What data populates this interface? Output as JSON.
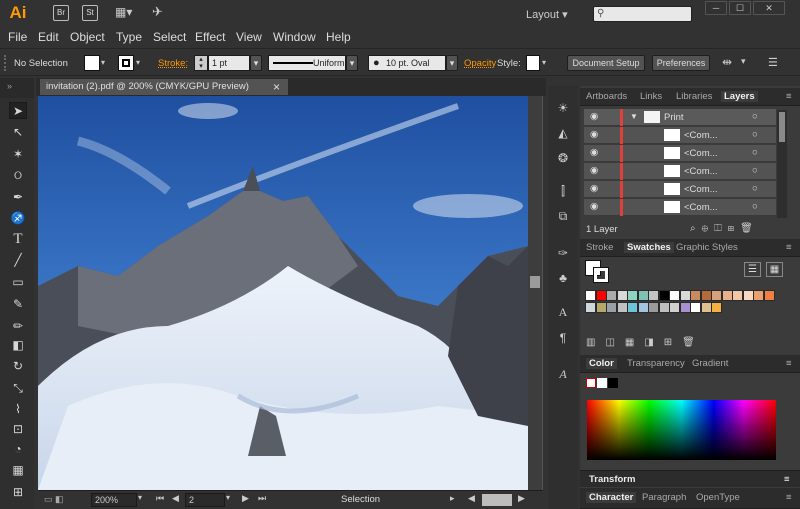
{
  "app": {
    "logo": "Ai",
    "br_icon": "Br",
    "st_icon": "St",
    "layout_label": "Layout",
    "search_placeholder": "",
    "window_buttons": [
      "─",
      "☐",
      "✕"
    ]
  },
  "menu": [
    "File",
    "Edit",
    "Object",
    "Type",
    "Select",
    "Effect",
    "View",
    "Window",
    "Help"
  ],
  "control": {
    "selection": "No Selection",
    "stroke_label": "Stroke:",
    "stroke_value": "1 pt",
    "profile": "Uniform",
    "brush": "10 pt. Oval",
    "opacity_label": "Opacity",
    "style_label": "Style:",
    "doc_setup": "Document Setup",
    "preferences": "Preferences"
  },
  "document": {
    "tab_title": "invitation (2).pdf @ 200% (CMYK/GPU Preview)",
    "close": "×"
  },
  "status": {
    "zoom": "200%",
    "page": "2",
    "mode": "Selection"
  },
  "layers_panel": {
    "tabs": [
      "Artboards",
      "Links",
      "Libraries",
      "Layers"
    ],
    "layers": [
      {
        "name": "Print"
      },
      {
        "name": "<Com..."
      },
      {
        "name": "<Com..."
      },
      {
        "name": "<Com..."
      },
      {
        "name": "<Com..."
      },
      {
        "name": "<Com..."
      }
    ],
    "count": "1 Layer"
  },
  "swatches_panel": {
    "tabs": [
      "Stroke",
      "Swatches",
      "Graphic Styles"
    ]
  },
  "color_panel": {
    "tabs": [
      "Color",
      "Transparency",
      "Gradient"
    ]
  },
  "transform_panel": {
    "title": "Transform"
  },
  "character_panel": {
    "tabs": [
      "Character",
      "Paragraph",
      "OpenType"
    ]
  },
  "colors": {
    "accent": "#ff9a00",
    "panel": "#3b3b3b",
    "layer_color": "#e0403a"
  },
  "swatch_row1": [
    "#ffffff",
    "#ff0000",
    "#aaaaaa",
    "#d9d9d9",
    "#8fd3c1",
    "#7ec2b5",
    "#c4c4c4",
    "#000000",
    "#ffffff",
    "#d9d9d9",
    "#c98a5f",
    "#b46a3a",
    "#d6a17c",
    "#e6b08c",
    "#f0c8a8",
    "#f6d9c0",
    "#e8a070",
    "#f07f45"
  ],
  "swatch_row2": [
    "#cfd8e0",
    "#b7a86a",
    "#9aa0a8",
    "#c2c2c2",
    "#6ec4d8",
    "#a3c4e0",
    "#9b9b9b",
    "#bfbfbf",
    "#d0d0d0",
    "#a88fd0",
    "#ffffff",
    "#e0c090",
    "#f4b040"
  ]
}
